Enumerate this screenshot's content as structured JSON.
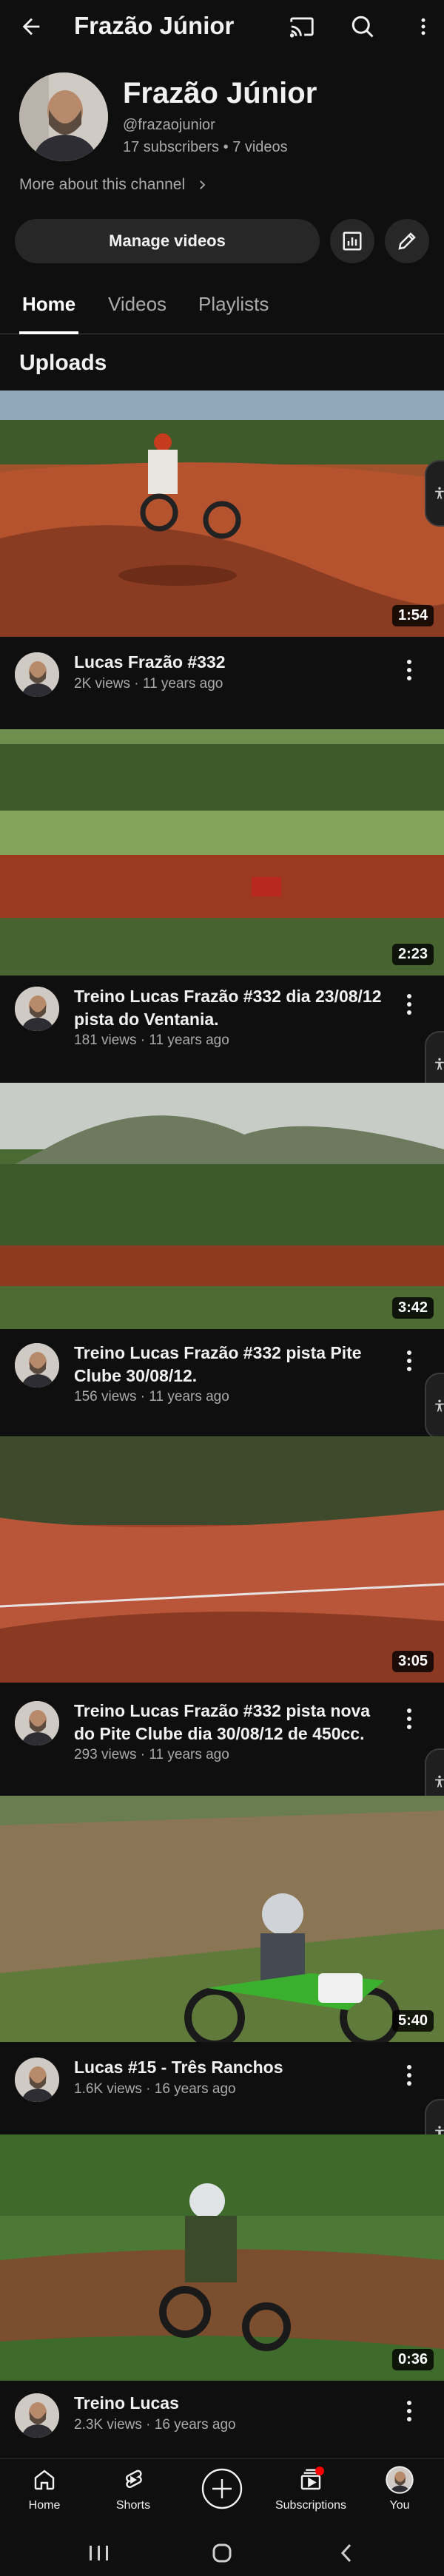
{
  "header": {
    "title": "Frazão Júnior"
  },
  "channel": {
    "name": "Frazão Júnior",
    "handle": "@frazaojunior",
    "subscribers": "17 subscribers",
    "videos_count": "7 videos",
    "separator": " • ",
    "more_about": "More about this channel"
  },
  "actions": {
    "manage_videos": "Manage videos"
  },
  "tabs": [
    {
      "label": "Home"
    },
    {
      "label": "Videos"
    },
    {
      "label": "Playlists"
    }
  ],
  "uploads_title": "Uploads",
  "videos": [
    {
      "title": "Lucas Frazão #332",
      "meta": "2K views · 11 years ago",
      "duration": "1:54"
    },
    {
      "title": "Treino Lucas Frazão #332 dia 23/08/12 pista do Ventania.",
      "meta": "181 views · 11 years ago",
      "duration": "2:23"
    },
    {
      "title": "Treino Lucas Frazão #332 pista Pite Clube 30/08/12.",
      "meta": "156 views · 11 years ago",
      "duration": "3:42"
    },
    {
      "title": "Treino Lucas Frazão #332 pista nova do Pite Clube dia 30/08/12 de 450cc.",
      "meta": "293 views · 11 years ago",
      "duration": "3:05"
    },
    {
      "title": "Lucas #15 - Três Ranchos",
      "meta": "1.6K views · 16 years ago",
      "duration": "5:40"
    },
    {
      "title": "Treino Lucas",
      "meta": "2.3K views · 16 years ago",
      "duration": "0:36"
    }
  ],
  "bottom_nav": [
    {
      "label": "Home",
      "icon": "home-icon"
    },
    {
      "label": "Shorts",
      "icon": "shorts-icon"
    },
    {
      "label": "",
      "icon": "create-icon"
    },
    {
      "label": "Subscriptions",
      "icon": "subscriptions-icon"
    },
    {
      "label": "You",
      "icon": "profile-avatar"
    }
  ],
  "colors": {
    "background": "#0f0f0f",
    "surface": "#272727",
    "notification": "#ff0000"
  }
}
